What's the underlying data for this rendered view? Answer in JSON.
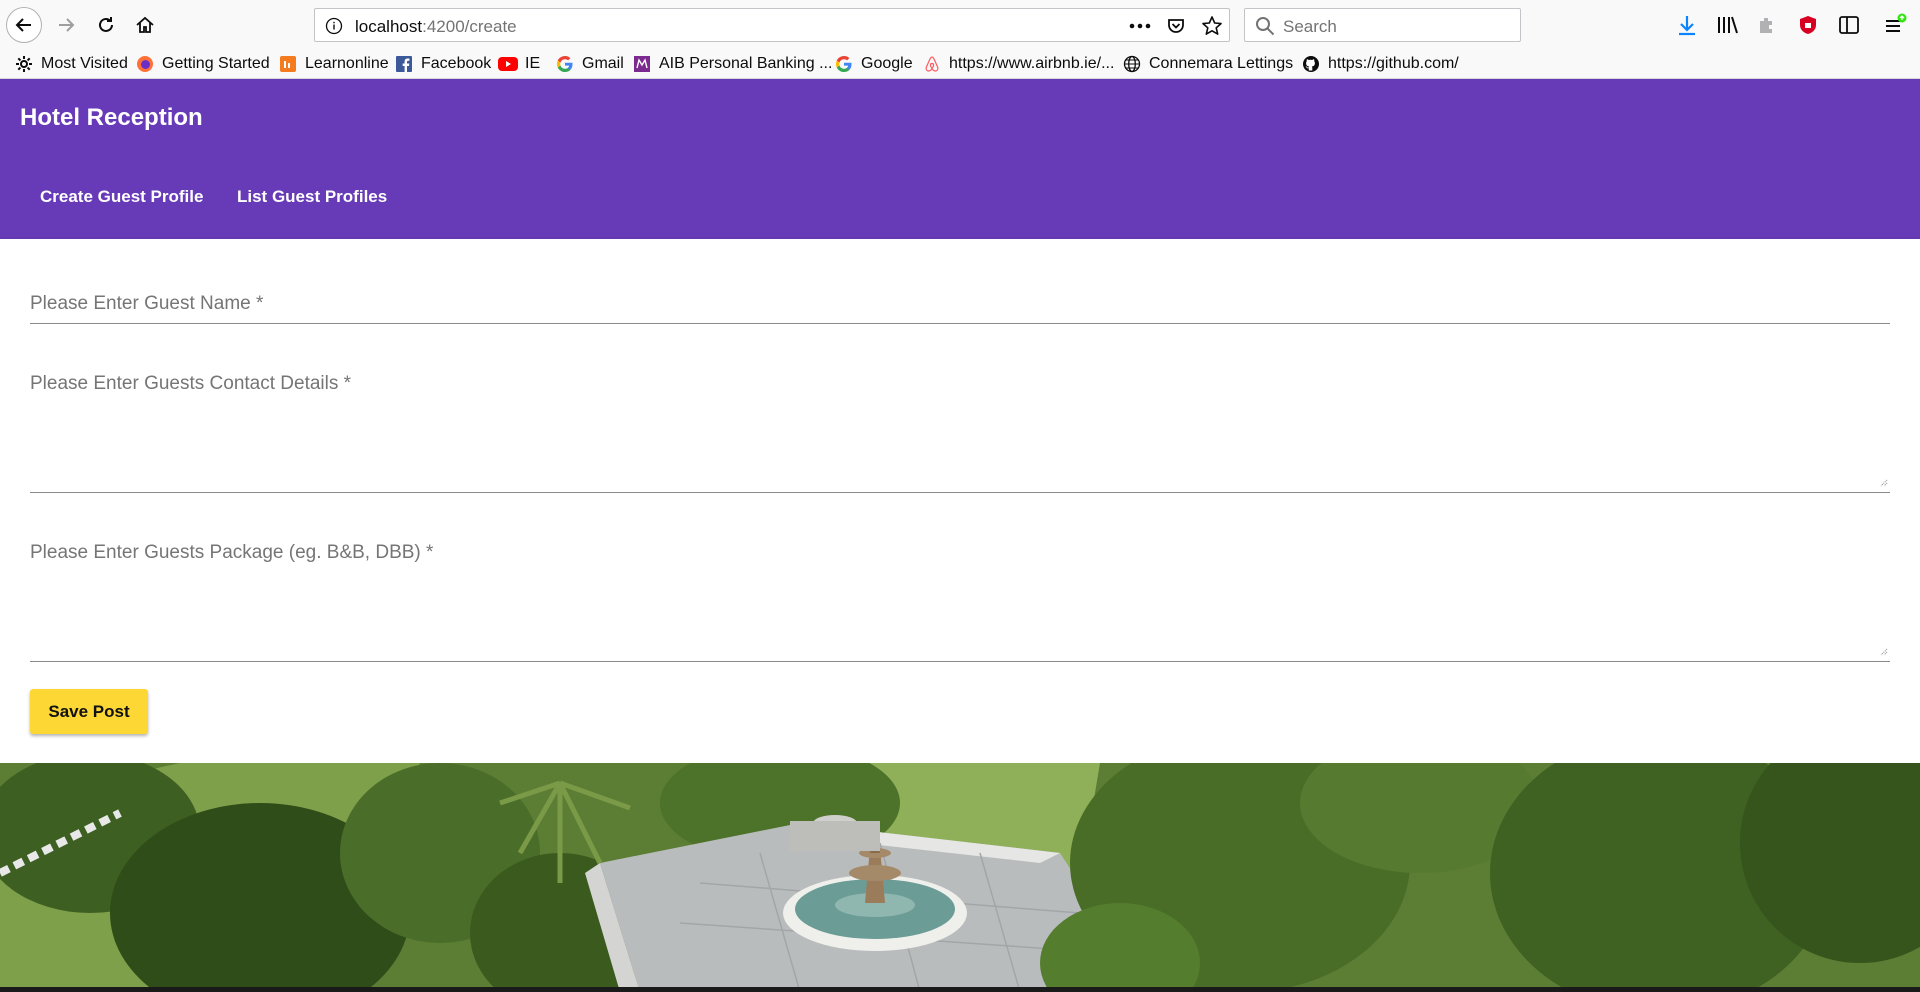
{
  "browser": {
    "url_host": "localhost",
    "url_path": ":4200/create",
    "search_placeholder": "Search",
    "bookmarks": [
      {
        "label": "Most Visited",
        "icon": "gear-icon"
      },
      {
        "label": "Getting Started",
        "icon": "firefox-icon"
      },
      {
        "label": "Learnonline",
        "icon": "learnonline-icon"
      },
      {
        "label": "Facebook",
        "icon": "facebook-icon"
      },
      {
        "label": "IE",
        "icon": "youtube-icon"
      },
      {
        "label": "Gmail",
        "icon": "google-icon"
      },
      {
        "label": "AIB Personal Banking ...",
        "icon": "aib-icon"
      },
      {
        "label": "Google",
        "icon": "google-icon"
      },
      {
        "label": "https://www.airbnb.ie/...",
        "icon": "airbnb-icon"
      },
      {
        "label": "Connemara Lettings",
        "icon": "globe-icon"
      },
      {
        "label": "https://github.com/",
        "icon": "github-icon"
      }
    ]
  },
  "app": {
    "title": "Hotel Reception",
    "nav": [
      {
        "label": "Create Guest Profile"
      },
      {
        "label": "List Guest Profiles"
      }
    ],
    "form": {
      "guest_name_label": "Please Enter Guest Name *",
      "contact_label": "Please Enter Guests Contact Details *",
      "package_label": "Please Enter Guests Package (eg. B&B, DBB) *",
      "save_label": "Save Post"
    }
  },
  "colors": {
    "primary": "#673ab7",
    "accent": "#fdd835"
  }
}
